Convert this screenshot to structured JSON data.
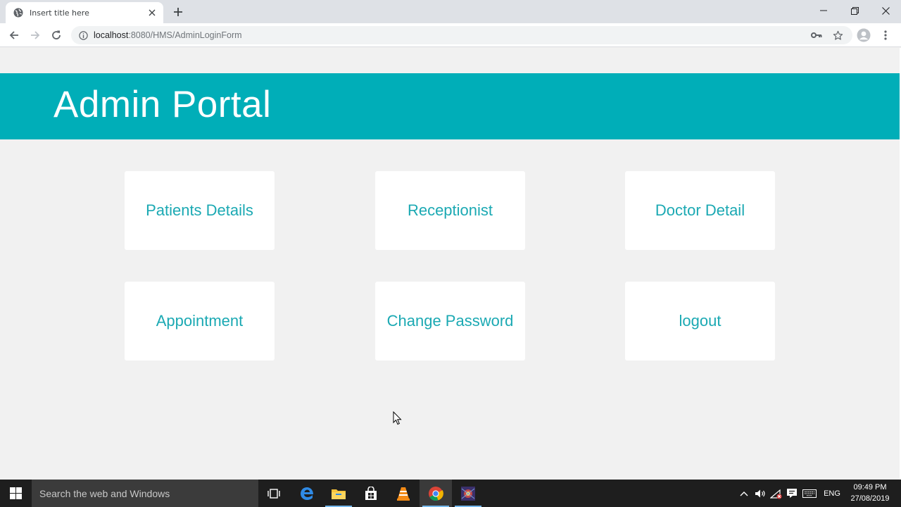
{
  "browser": {
    "tab_title": "Insert title here",
    "url_host": "localhost",
    "url_rest": ":8080/HMS/AdminLoginForm"
  },
  "page": {
    "heading": "Admin Portal",
    "tiles": [
      {
        "label": "Patients Details"
      },
      {
        "label": "Receptionist"
      },
      {
        "label": "Doctor Detail"
      },
      {
        "label": "Appointment"
      },
      {
        "label": "Change Password"
      },
      {
        "label": "logout"
      }
    ]
  },
  "taskbar": {
    "search_placeholder": "Search the web and Windows",
    "language": "ENG",
    "time": "09:49 PM",
    "date": "27/08/2019",
    "apps": [
      "task-view-icon",
      "edge-icon",
      "file-explorer-icon",
      "store-icon",
      "vlc-icon",
      "chrome-icon",
      "app-icon"
    ]
  },
  "colors": {
    "banner": "#00aeb8",
    "tile_text": "#1ba9b3",
    "page_bg": "#f1f1f1"
  }
}
